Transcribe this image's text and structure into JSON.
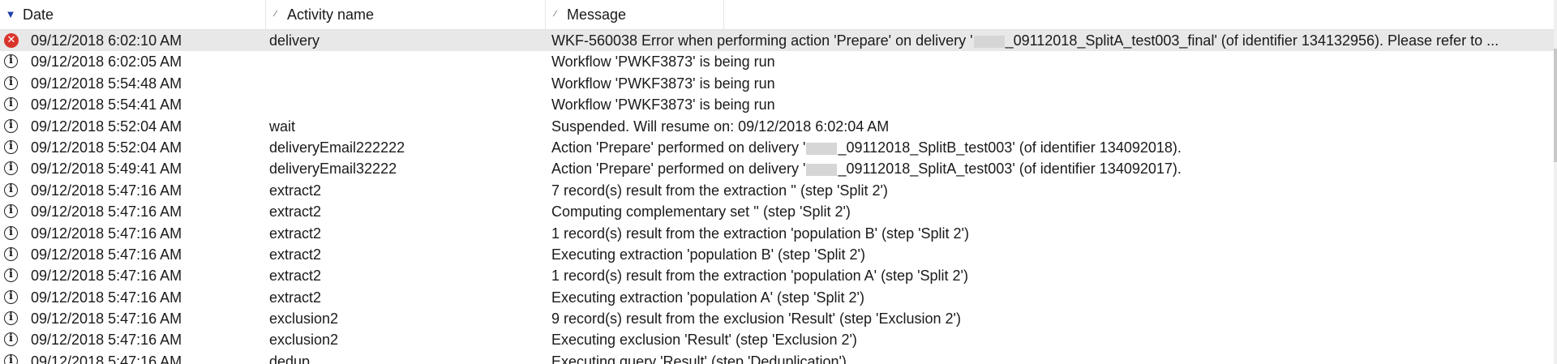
{
  "columns": {
    "date": "Date",
    "activity": "Activity name",
    "message": "Message"
  },
  "rows": [
    {
      "type": "error",
      "date": "09/12/2018 6:02:10 AM",
      "activity": "delivery",
      "msg_pre": "WKF-560038 Error when performing action 'Prepare' on delivery '",
      "msg_post": "_09112018_SplitA_test003_final' (of identifier 134132956). Please refer to ..."
    },
    {
      "type": "info",
      "date": "09/12/2018 6:02:05 AM",
      "activity": "",
      "msg_pre": "Workflow 'PWKF3873' is being run",
      "msg_post": ""
    },
    {
      "type": "info",
      "date": "09/12/2018 5:54:48 AM",
      "activity": "",
      "msg_pre": "Workflow 'PWKF3873' is being run",
      "msg_post": ""
    },
    {
      "type": "info",
      "date": "09/12/2018 5:54:41 AM",
      "activity": "",
      "msg_pre": "Workflow 'PWKF3873' is being run",
      "msg_post": ""
    },
    {
      "type": "info",
      "date": "09/12/2018 5:52:04 AM",
      "activity": "wait",
      "msg_pre": "Suspended. Will resume on: 09/12/2018 6:02:04 AM",
      "msg_post": ""
    },
    {
      "type": "info",
      "date": "09/12/2018 5:52:04 AM",
      "activity": "deliveryEmail222222",
      "msg_pre": "Action 'Prepare' performed on delivery '",
      "msg_post": "_09112018_SplitB_test003' (of identifier 134092018)."
    },
    {
      "type": "info",
      "date": "09/12/2018 5:49:41 AM",
      "activity": "deliveryEmail32222",
      "msg_pre": "Action 'Prepare' performed on delivery '",
      "msg_post": "_09112018_SplitA_test003' (of identifier 134092017)."
    },
    {
      "type": "info",
      "date": "09/12/2018 5:47:16 AM",
      "activity": "extract2",
      "msg_pre": "7 record(s) result from the extraction '' (step 'Split 2')",
      "msg_post": ""
    },
    {
      "type": "info",
      "date": "09/12/2018 5:47:16 AM",
      "activity": "extract2",
      "msg_pre": "Computing complementary set '' (step 'Split 2')",
      "msg_post": ""
    },
    {
      "type": "info",
      "date": "09/12/2018 5:47:16 AM",
      "activity": "extract2",
      "msg_pre": "1 record(s) result from the extraction 'population B' (step 'Split 2')",
      "msg_post": ""
    },
    {
      "type": "info",
      "date": "09/12/2018 5:47:16 AM",
      "activity": "extract2",
      "msg_pre": "Executing extraction 'population B' (step 'Split 2')",
      "msg_post": ""
    },
    {
      "type": "info",
      "date": "09/12/2018 5:47:16 AM",
      "activity": "extract2",
      "msg_pre": "1 record(s) result from the extraction 'population A' (step 'Split 2')",
      "msg_post": ""
    },
    {
      "type": "info",
      "date": "09/12/2018 5:47:16 AM",
      "activity": "extract2",
      "msg_pre": "Executing extraction 'population A' (step 'Split 2')",
      "msg_post": ""
    },
    {
      "type": "info",
      "date": "09/12/2018 5:47:16 AM",
      "activity": "exclusion2",
      "msg_pre": "9 record(s) result from the exclusion 'Result' (step 'Exclusion 2')",
      "msg_post": ""
    },
    {
      "type": "info",
      "date": "09/12/2018 5:47:16 AM",
      "activity": "exclusion2",
      "msg_pre": "Executing exclusion 'Result' (step 'Exclusion 2')",
      "msg_post": ""
    },
    {
      "type": "info",
      "date": "09/12/2018 5:47:16 AM",
      "activity": "dedup",
      "msg_pre": "Executing query 'Result' (step 'Deduplication')",
      "msg_post": ""
    }
  ],
  "icons": {
    "error": "error-icon",
    "info": "info-icon",
    "sort_date": "sort-descending-icon"
  },
  "colors": {
    "selected_row": "#e8e8e8",
    "error_icon": "#d9342b",
    "sort_arrow": "#1e3fa8"
  }
}
